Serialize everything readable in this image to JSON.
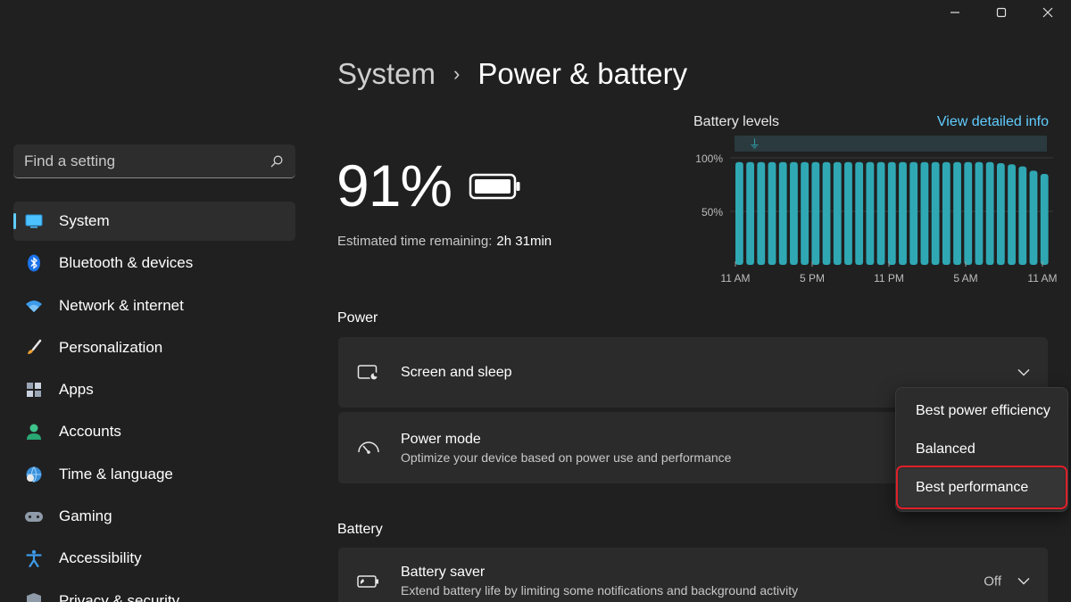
{
  "window": {
    "minimize_icon": "minimize-icon",
    "maximize_icon": "maximize-icon",
    "close_icon": "close-icon"
  },
  "search": {
    "placeholder": "Find a setting",
    "icon": "search-icon"
  },
  "sidebar": {
    "items": [
      {
        "label": "System",
        "icon": "monitor-icon",
        "active": true
      },
      {
        "label": "Bluetooth & devices",
        "icon": "bluetooth-icon"
      },
      {
        "label": "Network & internet",
        "icon": "wifi-icon"
      },
      {
        "label": "Personalization",
        "icon": "brush-icon"
      },
      {
        "label": "Apps",
        "icon": "apps-icon"
      },
      {
        "label": "Accounts",
        "icon": "person-icon"
      },
      {
        "label": "Time & language",
        "icon": "globe-clock-icon"
      },
      {
        "label": "Gaming",
        "icon": "gamepad-icon"
      },
      {
        "label": "Accessibility",
        "icon": "accessibility-icon"
      },
      {
        "label": "Privacy & security",
        "icon": "shield-icon"
      }
    ]
  },
  "header": {
    "parent": "System",
    "separator": "›",
    "current": "Power & battery"
  },
  "battery": {
    "percent": "91%",
    "estimated_label": "Estimated time remaining:",
    "estimated_value": "2h 31min"
  },
  "chart": {
    "title": "Battery levels",
    "link": "View detailed info"
  },
  "chart_data": {
    "type": "bar",
    "title": "Battery levels",
    "y_tick_labels": [
      "100%",
      "50%"
    ],
    "x_tick_labels": [
      "11 AM",
      "5 PM",
      "11 PM",
      "5 AM",
      "11 AM"
    ],
    "ylim": [
      0,
      100
    ],
    "bar_color": "#2fa8b4",
    "values": [
      96,
      96,
      96,
      96,
      96,
      96,
      96,
      96,
      96,
      96,
      96,
      96,
      96,
      96,
      96,
      96,
      96,
      96,
      96,
      96,
      96,
      96,
      96,
      96,
      95,
      94,
      92,
      88,
      85
    ],
    "plugged_in_marker": "plug-icon"
  },
  "power": {
    "section_label": "Power",
    "screen_sleep": {
      "title": "Screen and sleep",
      "icon": "screen-sleep-icon"
    },
    "power_mode": {
      "title": "Power mode",
      "desc": "Optimize your device based on power use and performance",
      "icon": "gauge-icon",
      "options": [
        "Best power efficiency",
        "Balanced",
        "Best performance"
      ],
      "selected": "Best performance"
    }
  },
  "battery_section": {
    "section_label": "Battery",
    "saver": {
      "title": "Battery saver",
      "desc": "Extend battery life by limiting some notifications and background activity",
      "status": "Off",
      "icon": "battery-saver-icon"
    }
  },
  "colors": {
    "accent": "#60cdff",
    "background": "#202020",
    "card": "#2b2b2b",
    "highlight": "#e0202a"
  }
}
